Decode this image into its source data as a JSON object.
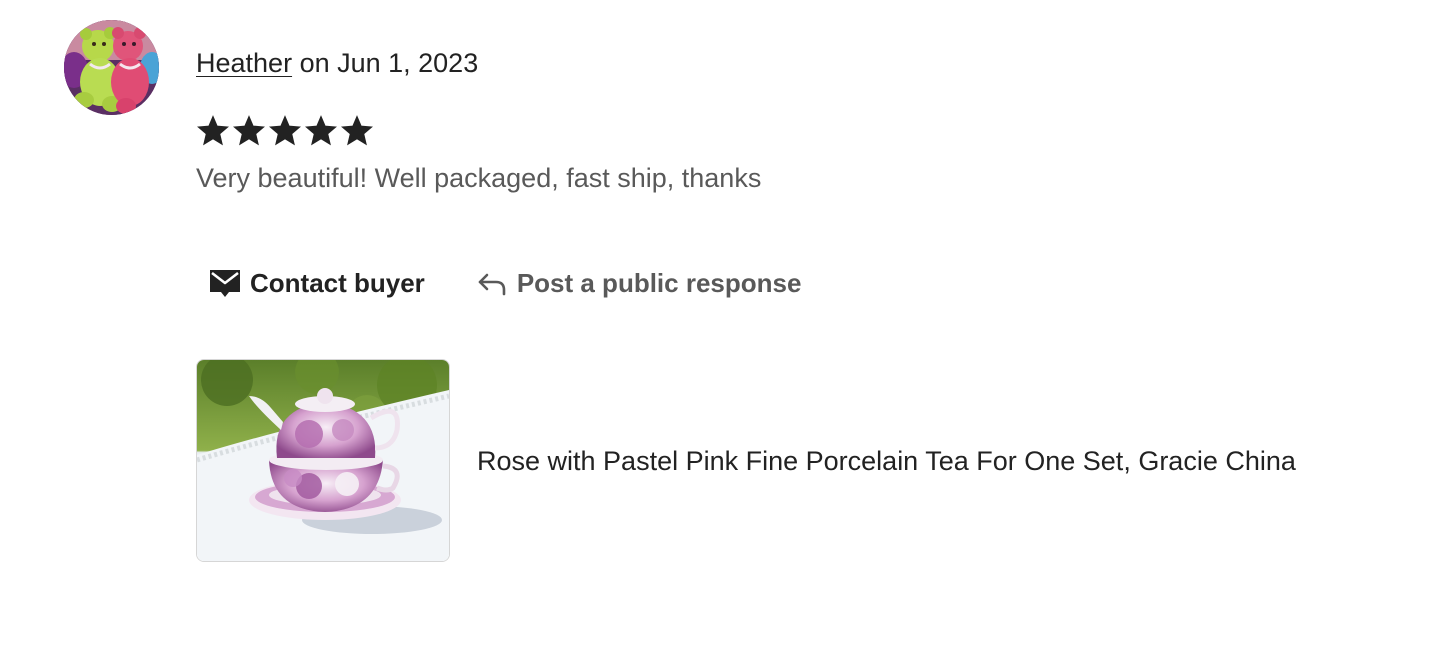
{
  "review": {
    "reviewer_name": "Heather",
    "date_text": " on Jun 1, 2023",
    "rating": 5,
    "rating_max": 5,
    "text": "Very beautiful! Well packaged, fast ship, thanks",
    "star_color": "#222222"
  },
  "actions": {
    "contact_label": "Contact buyer",
    "contact_icon": "envelope-icon",
    "respond_label": "Post a public response",
    "respond_icon": "reply-arrow-icon"
  },
  "listing": {
    "title": "Rose with Pastel Pink Fine Porcelain Tea For One Set, Gracie China"
  },
  "colors": {
    "text_primary": "#222222",
    "text_secondary": "#595959",
    "thumb_border": "#d6d6d6"
  }
}
